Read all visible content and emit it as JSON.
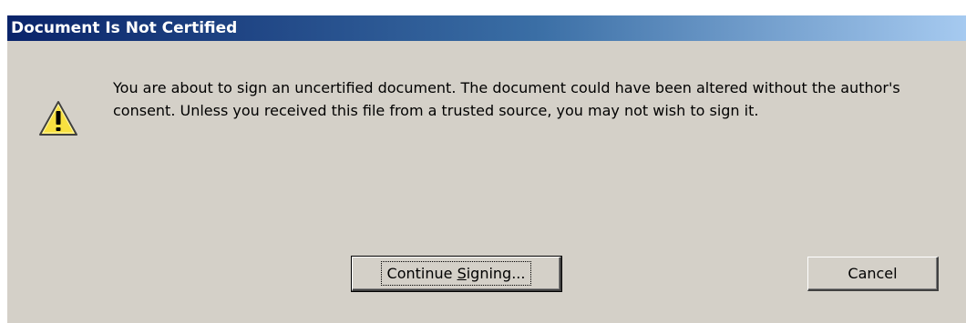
{
  "dialog": {
    "title": "Document Is Not Certified",
    "message": "You are about to sign an uncertified document. The document could have been altered without the author's consent. Unless you received this file from a trusted source, you may not wish to sign it.",
    "icon": "warning-icon",
    "buttons": {
      "continue_label_pre": "Continue ",
      "continue_label_mnemonic": "S",
      "continue_label_post": "igning...",
      "cancel_label": "Cancel"
    }
  },
  "colors": {
    "title_start": "#0a246a",
    "title_end": "#a6caf0",
    "background": "#d4d0c8",
    "warning_fill": "#f8e040"
  }
}
